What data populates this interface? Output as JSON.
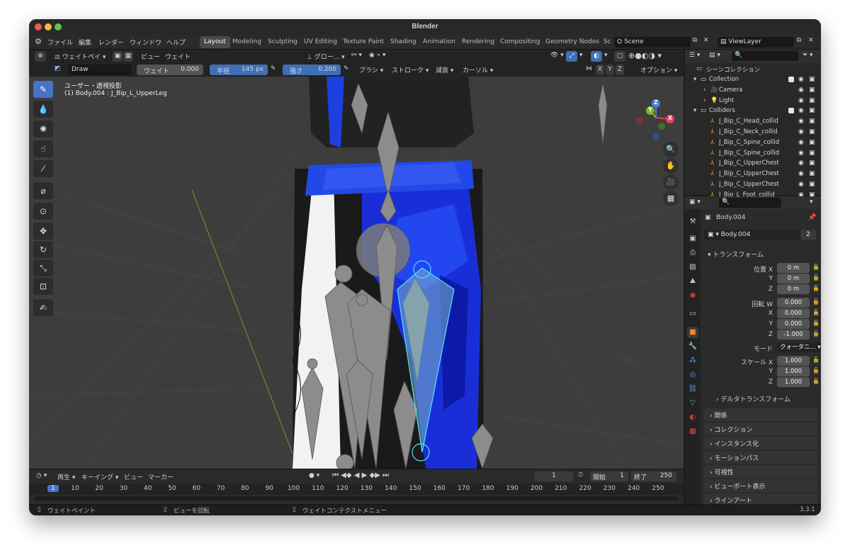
{
  "window": {
    "title": "Blender",
    "version": "3.3.1"
  },
  "menu": [
    "ファイル",
    "編集",
    "レンダー",
    "ウィンドウ",
    "ヘルプ"
  ],
  "workspaces": [
    {
      "label": "Layout",
      "active": true
    },
    {
      "label": "Modeling",
      "active": false
    },
    {
      "label": "Sculpting",
      "active": false
    },
    {
      "label": "UV Editing",
      "active": false
    },
    {
      "label": "Texture Paint",
      "active": false
    },
    {
      "label": "Shading",
      "active": false
    },
    {
      "label": "Animation",
      "active": false
    },
    {
      "label": "Rendering",
      "active": false
    },
    {
      "label": "Compositing",
      "active": false
    },
    {
      "label": "Geometry Nodes",
      "active": false
    },
    {
      "label": "Sc",
      "active": false
    }
  ],
  "scene": {
    "name": "Scene",
    "view_layer": "ViewLayer"
  },
  "header": {
    "mode": "ウェイトペイ",
    "view": "ビュー",
    "weights": "ウェイト",
    "orientation": "グロー...",
    "x": "X",
    "y": "Y",
    "z": "Z",
    "options": "オプション"
  },
  "brush": {
    "name": "Draw",
    "weight_label": "ウェイト",
    "weight_value": "0.000",
    "radius_label": "半径",
    "radius_value": "145 px",
    "strength_label": "強さ",
    "strength_value": "0.200",
    "brush_menu": "ブラシ",
    "stroke_menu": "ストローク",
    "falloff_menu": "減衰",
    "cursor_menu": "カーソル"
  },
  "viewport": {
    "view_name": "ユーザー・透視投影",
    "object_info": "(1) Body.004 : J_Bip_L_UpperLeg",
    "gizmo_x": "X",
    "gizmo_y": "Y",
    "gizmo_z": "Z"
  },
  "outliner": {
    "title": "シーンコレクション",
    "items": [
      {
        "label": "Collection",
        "depth": 0,
        "type": "collection"
      },
      {
        "label": "Camera",
        "depth": 1,
        "type": "camera"
      },
      {
        "label": "Light",
        "depth": 1,
        "type": "light"
      },
      {
        "label": "Colliders",
        "depth": 0,
        "type": "collection"
      },
      {
        "label": "J_Bip_C_Head_collid",
        "depth": 1,
        "type": "empty"
      },
      {
        "label": "J_Bip_C_Neck_collid",
        "depth": 1,
        "type": "empty"
      },
      {
        "label": "J_Bip_C_Spine_collid",
        "depth": 1,
        "type": "empty"
      },
      {
        "label": "J_Bip_C_Spine_collid",
        "depth": 1,
        "type": "empty"
      },
      {
        "label": "J_Bip_C_UpperChest",
        "depth": 1,
        "type": "empty"
      },
      {
        "label": "J_Bip_C_UpperChest",
        "depth": 1,
        "type": "empty"
      },
      {
        "label": "J_Bip_C_UpperChest",
        "depth": 1,
        "type": "empty"
      },
      {
        "label": "J_Bip_L_Foot_collid",
        "depth": 1,
        "type": "empty"
      }
    ]
  },
  "properties": {
    "object_name": "Body.004",
    "data_name": "Body.004",
    "data_users": "2",
    "transform_title": "トランスフォーム",
    "location_label": "位置 X",
    "location": [
      "0 m",
      "0 m",
      "0 m"
    ],
    "rotation_label": "回転 W",
    "rotation": [
      "0.000",
      "0.000",
      "0.000",
      "-1.000"
    ],
    "mode_label": "モード",
    "mode_value": "クォータニ...",
    "scale_label": "スケール X",
    "scale": [
      "1.000",
      "1.000",
      "1.000"
    ],
    "axis_y": "Y",
    "axis_z": "Z",
    "axis_x": "X",
    "delta": "デルタトランスフォーム",
    "sections": [
      "関係",
      "コレクション",
      "インスタンス化",
      "モーションパス",
      "可視性",
      "ビューポート表示",
      "ラインアート"
    ]
  },
  "timeline": {
    "playback": "再生",
    "keying": "キーイング",
    "view": "ビュー",
    "marker": "マーカー",
    "current_frame": "1",
    "start_label": "開始",
    "start": "1",
    "end_label": "終了",
    "end": "250",
    "ticks": [
      "1",
      "10",
      "20",
      "30",
      "40",
      "50",
      "60",
      "70",
      "80",
      "90",
      "100",
      "110",
      "120",
      "130",
      "140",
      "150",
      "160",
      "170",
      "180",
      "190",
      "200",
      "210",
      "220",
      "230",
      "240",
      "250"
    ]
  },
  "status": {
    "left": "ウェイトペイント",
    "middle": "ビューを回転",
    "right": "ウェイトコンテクストメニュー"
  }
}
